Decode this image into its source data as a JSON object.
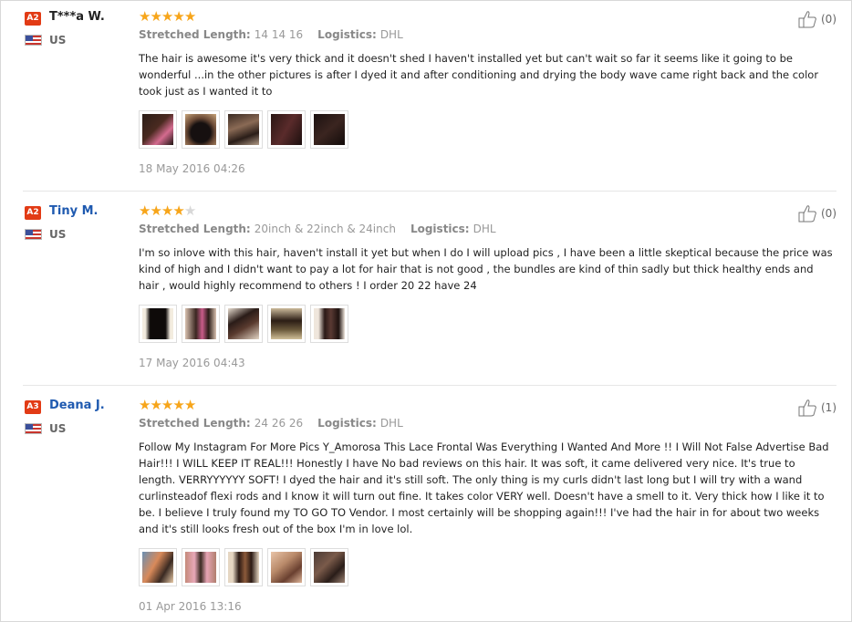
{
  "labels": {
    "length": "Stretched Length:",
    "logistics": "Logistics:"
  },
  "reviews": [
    {
      "badge": "A2",
      "name": "T***a W.",
      "country": "US",
      "rating": 5,
      "length": "14 14 16",
      "logistics": "DHL",
      "text": "The hair is awesome it's very thick and it doesn't shed I haven't installed yet but can't wait so far it seems like it going to be wonderful ...in the other pictures is after I dyed it and after conditioning and drying the body wave came right back and the color took just as I wanted it to",
      "photo_count": 5,
      "date": "18 May 2016 04:26",
      "helpful": "(0)"
    },
    {
      "badge": "A2",
      "name": "Tiny M.",
      "country": "US",
      "rating": 4,
      "length": "20inch & 22inch & 24inch",
      "logistics": "DHL",
      "text": "I'm so inlove with this hair, haven't install it yet but when I do I will upload pics , I have been a little skeptical because the price was kind of high and I didn't want to pay a lot for hair that is not good , the bundles are kind of thin sadly but thick healthy ends and hair , would highly recommend to others ! I order 20 22 have 24",
      "photo_count": 5,
      "date": "17 May 2016 04:43",
      "helpful": "(0)"
    },
    {
      "badge": "A3",
      "name": "Deana J.",
      "country": "US",
      "rating": 5,
      "length": "24 26 26",
      "logistics": "DHL",
      "text": "Follow My Instagram For More Pics Y_Amorosa This Lace Frontal Was Everything I Wanted And More !! I Will Not False Advertise Bad Hair!!! I WILL KEEP IT REAL!!! Honestly I have No bad reviews on this hair. It was soft, it came delivered very nice. It's true to length. VERRYYYYYY SOFT! I dyed the hair and it's still soft. The only thing is my curls didn't last long but I will try with a wand curlinsteadof flexi rods and I know it will turn out fine. It takes color VERY well. Doesn't have a smell to it. Very thick how I like it to be. I believe I truly found my TO GO TO Vendor. I most certainly will be shopping again!!! I've had the hair in for about two weeks and it's still looks fresh out of the box I'm in love lol.",
      "photo_count": 5,
      "date": "01 Apr 2016 13:16",
      "helpful": "(1)"
    }
  ]
}
